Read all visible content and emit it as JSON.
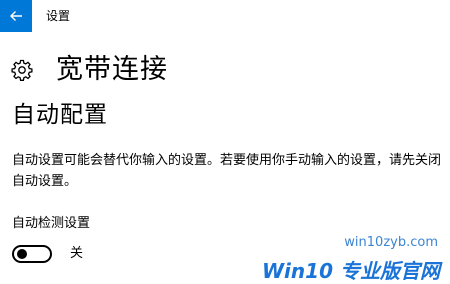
{
  "window": {
    "title": "设置",
    "back_icon": "back-arrow-icon"
  },
  "header": {
    "icon": "gear-icon",
    "title": "宽带连接"
  },
  "section": {
    "title": "自动配置",
    "description": "自动设置可能会替代你输入的设置。若要使用你手动输入的设置，请先关闭自动设置。"
  },
  "auto_detect": {
    "label": "自动检测设置",
    "state_label": "关",
    "enabled": false
  },
  "watermark": {
    "url": "win10zyb.com",
    "logo_text": "Win10 专业版官网"
  },
  "colors": {
    "accent": "#0078d7",
    "watermark": "#1a73d6"
  }
}
